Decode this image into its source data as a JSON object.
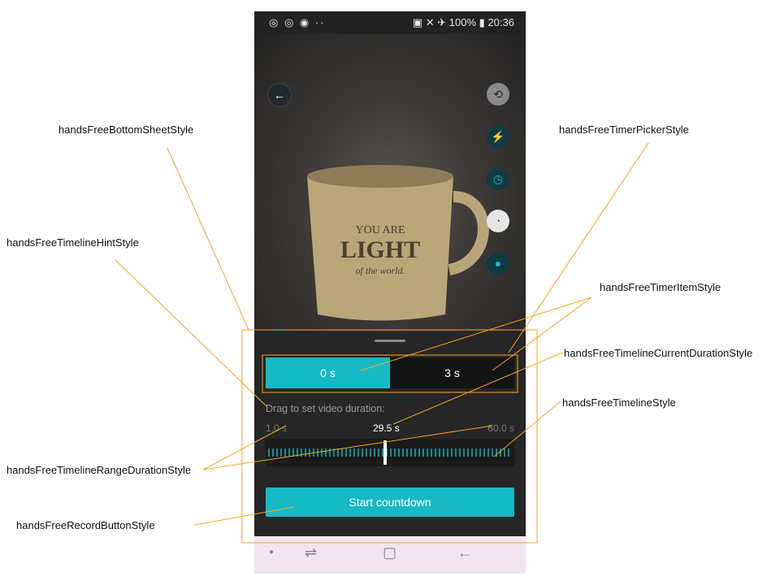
{
  "status_bar": {
    "left_icons": [
      "notification-icon",
      "notification-icon",
      "profile-icon",
      "more-icon"
    ],
    "battery": "100%",
    "time": "20:36"
  },
  "camera": {
    "side_controls": [
      "switch-camera-icon",
      "flash-icon",
      "timer-icon",
      "speed-icon",
      "mic-icon"
    ]
  },
  "bottom_sheet": {
    "timer_picker": {
      "items": [
        "0 s",
        "3 s"
      ],
      "selected_index": 0
    },
    "hint": "Drag to set video duration:",
    "range_min": "1.0 s",
    "range_max": "60.0 s",
    "current_duration": "29.5 s",
    "current_fraction": 0.48,
    "record_button": "Start countdown"
  },
  "annotations": {
    "bottom_sheet": "handsFreeBottomSheetStyle",
    "timeline_hint": "handsFreeTimelineHintStyle",
    "timeline_range_duration": "handsFreeTimelineRangeDurationStyle",
    "record_button": "handsFreeRecordButtonStyle",
    "timer_picker": "handsFreeTimerPickerStyle",
    "timer_item": "handsFreeTimerItemStyle",
    "timeline_current_duration": "handsFreeTimelineCurrentDurationStyle",
    "timeline": "handsFreeTimelineStyle"
  },
  "colors": {
    "accent": "#16bac4",
    "annotation_line": "#f5a623",
    "sheet_background": "#262626"
  }
}
